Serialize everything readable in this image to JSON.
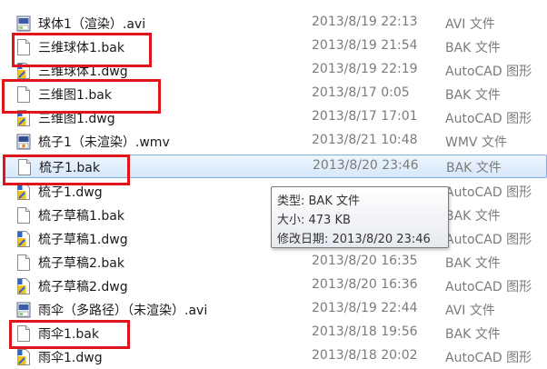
{
  "rows": [
    {
      "name": "球体1（渲染）.avi",
      "date": "2013/8/19 22:13",
      "type": "AVI 文件",
      "icon": "avi-video-icon"
    },
    {
      "name": "三维球体1.bak",
      "date": "2013/8/19 21:54",
      "type": "BAK 文件",
      "icon": "blank-file-icon"
    },
    {
      "name": "三维球体1.dwg",
      "date": "2013/8/19 22:19",
      "type": "AutoCAD 图形",
      "icon": "autocad-dwg-icon"
    },
    {
      "name": "三维图1.bak",
      "date": "2013/8/17 0:05",
      "type": "BAK 文件",
      "icon": "blank-file-icon"
    },
    {
      "name": "三维图1.dwg",
      "date": "2013/8/17 17:01",
      "type": "AutoCAD 图形",
      "icon": "autocad-dwg-icon"
    },
    {
      "name": "梳子1（未渲染）.wmv",
      "date": "2013/8/21 10:48",
      "type": "WMV 文件",
      "icon": "wmv-video-icon"
    },
    {
      "name": "梳子1.bak",
      "date": "2013/8/20 23:46",
      "type": "BAK 文件",
      "icon": "blank-file-icon"
    },
    {
      "name": "梳子1.dwg",
      "date": "",
      "type": "AutoCAD 图形",
      "icon": "autocad-dwg-icon"
    },
    {
      "name": "梳子草稿1.bak",
      "date": "",
      "type": "BAK 文件",
      "icon": "blank-file-icon"
    },
    {
      "name": "梳子草稿1.dwg",
      "date": "",
      "type": "AutoCAD 图形",
      "icon": "autocad-dwg-icon"
    },
    {
      "name": "梳子草稿2.bak",
      "date": "2013/8/20 16:35",
      "type": "BAK 文件",
      "icon": "blank-file-icon"
    },
    {
      "name": "梳子草稿2.dwg",
      "date": "2013/8/20 16:36",
      "type": "AutoCAD 图形",
      "icon": "autocad-dwg-icon"
    },
    {
      "name": "雨伞（多路径）（未渲染）.avi",
      "date": "2013/8/19 22:44",
      "type": "AVI 文件",
      "icon": "avi-video-icon"
    },
    {
      "name": "雨伞1.bak",
      "date": "2013/8/18 19:56",
      "type": "BAK 文件",
      "icon": "blank-file-icon"
    },
    {
      "name": "雨伞1.dwg",
      "date": "2013/8/18 20:02",
      "type": "AutoCAD 图形",
      "icon": "autocad-dwg-icon"
    }
  ],
  "selected_index": 6,
  "highlighted_indices": [
    1,
    3,
    6,
    13
  ],
  "tooltip": {
    "type_line": "类型: BAK 文件",
    "size_line": "大小: 473 KB",
    "modified_line": "修改日期: 2013/8/20 23:46"
  },
  "colors": {
    "callout_red": "#e0151c",
    "selection_border": "#84acdd",
    "secondary_text": "#7b7b7b"
  }
}
